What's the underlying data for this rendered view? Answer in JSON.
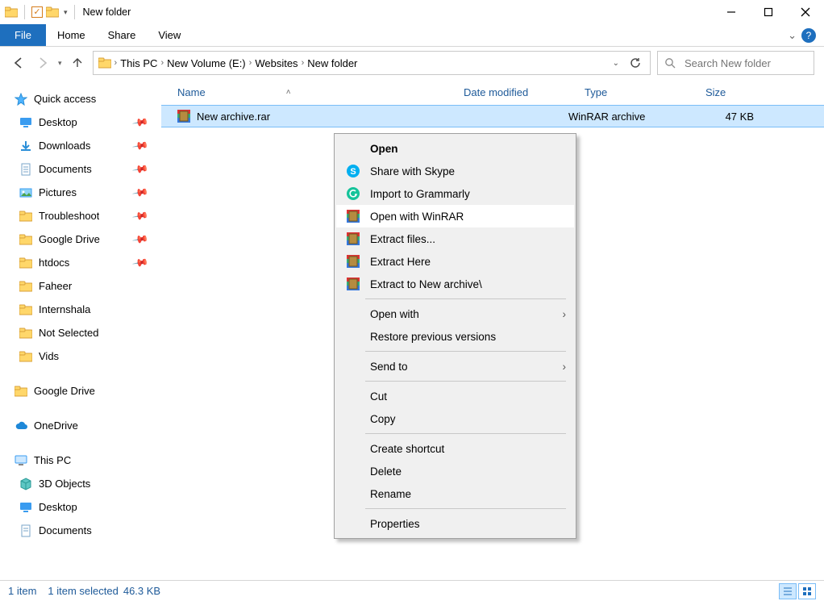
{
  "title": "New folder",
  "ribbon_tabs": {
    "file": "File",
    "home": "Home",
    "share": "Share",
    "view": "View"
  },
  "breadcrumbs": [
    "This PC",
    "New Volume (E:)",
    "Websites",
    "New folder"
  ],
  "search_placeholder": "Search New folder",
  "columns": {
    "name": "Name",
    "date": "Date modified",
    "type": "Type",
    "size": "Size"
  },
  "file_row": {
    "name": "New archive.rar",
    "date": "",
    "type": "WinRAR archive",
    "size": "47 KB"
  },
  "sidebar": {
    "quick_access": "Quick access",
    "pinned": [
      "Desktop",
      "Downloads",
      "Documents",
      "Pictures",
      "Troubleshoot",
      "Google Drive",
      "htdocs"
    ],
    "recent": [
      "Faheer",
      "Internshala",
      "Not Selected",
      "Vids"
    ],
    "google_drive": "Google Drive",
    "onedrive": "OneDrive",
    "this_pc": "This PC",
    "pc_children": [
      "3D Objects",
      "Desktop",
      "Documents"
    ]
  },
  "context_menu": {
    "open": "Open",
    "skype": "Share with Skype",
    "grammarly": "Import to Grammarly",
    "open_winrar": "Open with WinRAR",
    "extract_files": "Extract files...",
    "extract_here": "Extract Here",
    "extract_to": "Extract to New archive\\",
    "open_with": "Open with",
    "restore": "Restore previous versions",
    "send_to": "Send to",
    "cut": "Cut",
    "copy": "Copy",
    "create_shortcut": "Create shortcut",
    "delete": "Delete",
    "rename": "Rename",
    "properties": "Properties"
  },
  "status": {
    "items": "1 item",
    "selected": "1 item selected",
    "size": "46.3 KB"
  }
}
